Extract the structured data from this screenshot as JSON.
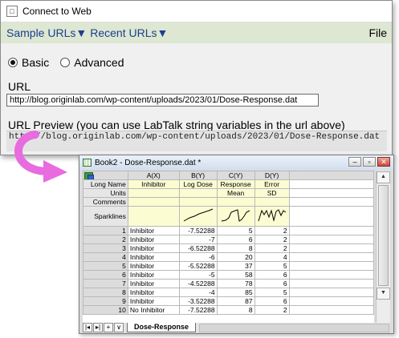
{
  "dialog": {
    "title": "Connect to Web",
    "menu": {
      "sample_urls": "Sample URLs▼",
      "recent_urls": "Recent URLs▼",
      "file": "File"
    },
    "mode": {
      "basic": "Basic",
      "advanced": "Advanced",
      "selected": "Basic"
    },
    "url_label": "URL",
    "url_value": "http://blog.originlab.com/wp-content/uploads/2023/01/Dose-Response.dat",
    "preview_label": "URL Preview (you can use LabTalk string variables in the url above)",
    "preview_value": "http://blog.originlab.com/wp-content/uploads/2023/01/Dose-Response.dat"
  },
  "workbook": {
    "title": "Book2 - Dose-Response.dat *",
    "columns": [
      "A(X)",
      "B(Y)",
      "C(Y)",
      "D(Y)"
    ],
    "meta_rows": [
      {
        "label": "Long Name",
        "values": [
          "Inhibitor",
          "Log Dose",
          "Response",
          "Error"
        ]
      },
      {
        "label": "Units",
        "values": [
          "",
          "",
          "Mean",
          "SD"
        ]
      },
      {
        "label": "Comments",
        "values": [
          "",
          "",
          "",
          ""
        ]
      }
    ],
    "sparkline_label": "Sparklines",
    "rows": [
      {
        "n": "1",
        "a": "Inhibitor",
        "b": "-7.52288",
        "c": "5",
        "d": "2"
      },
      {
        "n": "2",
        "a": "Inhibitor",
        "b": "-7",
        "c": "6",
        "d": "2"
      },
      {
        "n": "3",
        "a": "Inhibitor",
        "b": "-6.52288",
        "c": "8",
        "d": "2"
      },
      {
        "n": "4",
        "a": "Inhibitor",
        "b": "-6",
        "c": "20",
        "d": "4"
      },
      {
        "n": "5",
        "a": "Inhibitor",
        "b": "-5.52288",
        "c": "37",
        "d": "5"
      },
      {
        "n": "6",
        "a": "Inhibitor",
        "b": "-5",
        "c": "58",
        "d": "6"
      },
      {
        "n": "7",
        "a": "Inhibitor",
        "b": "-4.52288",
        "c": "78",
        "d": "6"
      },
      {
        "n": "8",
        "a": "Inhibitor",
        "b": "-4",
        "c": "85",
        "d": "5"
      },
      {
        "n": "9",
        "a": "Inhibitor",
        "b": "-3.52288",
        "c": "87",
        "d": "6"
      },
      {
        "n": "10",
        "a": "No Inhibitor",
        "b": "-7.52288",
        "c": "8",
        "d": "2"
      }
    ],
    "sheet_nav": [
      "|◂",
      "▸|",
      "+",
      "∨"
    ],
    "sheet_tab": "Dose-Response",
    "window_buttons": [
      "–",
      "▫",
      "✕"
    ]
  },
  "icons": {
    "dialog_app_icon": "window-icon",
    "workbook_icon": "workbook-icon",
    "arrow": "curved-arrow-icon"
  },
  "colors": {
    "menubar_bg": "#dde7d2",
    "menu_link": "#1b3f8f",
    "header_yellow": "#fcfcd2",
    "arrow": "#e86be0"
  }
}
